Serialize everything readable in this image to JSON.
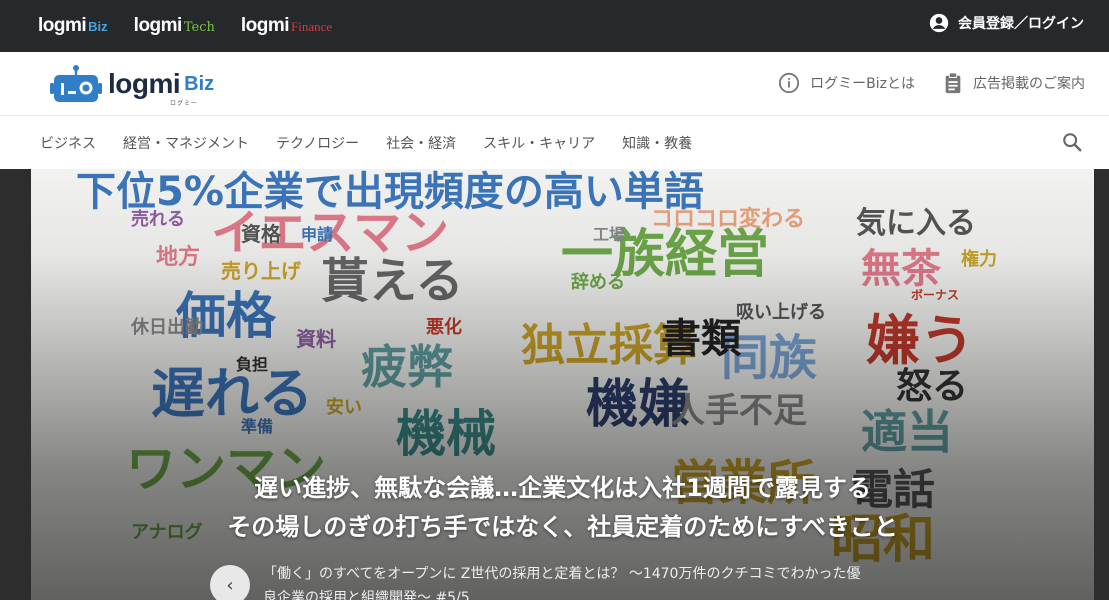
{
  "topbar": {
    "sites": [
      {
        "name": "logmi",
        "sub": "Biz"
      },
      {
        "name": "logmi",
        "sub": "Tech"
      },
      {
        "name": "logmi",
        "sub": "Finance"
      }
    ],
    "login_label": "会員登録／ログイン"
  },
  "header": {
    "logo_word": "logmi",
    "logo_biz": "Biz",
    "logo_kana": "ログミー",
    "links": [
      {
        "label": "ログミーBizとは",
        "icon": "info-icon"
      },
      {
        "label": "広告掲載のご案内",
        "icon": "clipboard-icon"
      }
    ]
  },
  "nav": {
    "items": [
      "ビジネス",
      "経営・マネジメント",
      "テクノロジー",
      "社会・経済",
      "スキル・キャリア",
      "知識・教養"
    ]
  },
  "hero": {
    "image_title": "下位5%企業で出現頻度の高い単語",
    "headline_line1": "遅い進捗、無駄な会議…企業文化は入社1週間で露見する",
    "headline_line2": "その場しのぎの打ち手ではなく、社員定着のためにすべきこと",
    "caption": "「働く」のすべてをオープンに Z世代の採用と定着とは？ 〜1470万件のクチコミでわかった優良企業の採用と組織開発〜 #5/5",
    "words": [
      "イエスマン",
      "一族経営",
      "価格",
      "貰える",
      "遅れる",
      "疲弊",
      "機械",
      "機嫌",
      "独立採算",
      "同族",
      "嫌う",
      "怒る",
      "書類",
      "人手不足",
      "適当",
      "電話",
      "昭和",
      "ワンマン",
      "無茶",
      "気に入る",
      "コロコロ変わる",
      "売り上げ",
      "資格",
      "申請",
      "売れる",
      "地方",
      "休日出勤",
      "資料",
      "負担",
      "準備",
      "安い",
      "悪化",
      "辞める",
      "吸い上げる",
      "ボーナス",
      "権力",
      "工場",
      "アナログ",
      "営業所"
    ]
  },
  "colors": {
    "topbar_bg": "#26292c",
    "biz": "#4aa3e0",
    "tech": "#7cc142",
    "finance": "#d8393b",
    "title_blue": "#3a73b8"
  }
}
